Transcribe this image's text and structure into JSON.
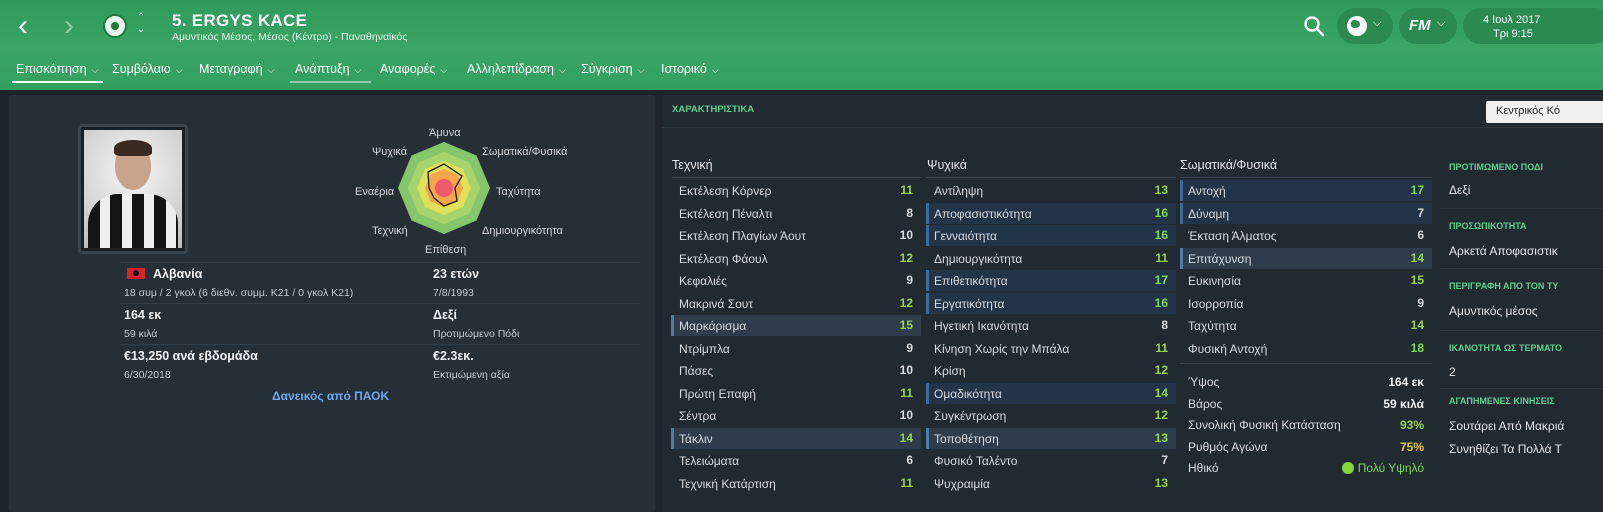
{
  "header": {
    "back_icon": "chevron-left-icon",
    "forward_icon": "chevron-right-icon",
    "player_name": "5. ERGYS KACE",
    "player_sub": "Αμυντικός Μέσος, Μέσος (Κέντρο) - Παναθηναϊκός",
    "fm_logo": "FM",
    "date": "4 Ιουλ 2017",
    "day_time": "Τρι 9:15"
  },
  "tabs": [
    {
      "label": "Επισκόπηση",
      "active": true
    },
    {
      "label": "Συμβόλαιο"
    },
    {
      "label": "Μεταγραφή"
    },
    {
      "label": "Ανάπτυξη"
    },
    {
      "label": "Αναφορές"
    },
    {
      "label": "Αλληλεπίδραση"
    },
    {
      "label": "Σύγκριση"
    },
    {
      "label": "Ιστορικό"
    }
  ],
  "radar": {
    "labels": {
      "top": "Άμυνα",
      "top_right": "Σωματικά/Φυσικά",
      "right": "Ταχύτητα",
      "bottom_right": "Δημιουργικότητα",
      "bottom": "Επίθεση",
      "bottom_left": "Τεχνική",
      "left": "Εναέρια",
      "top_left": "Ψυχικά"
    }
  },
  "info": {
    "nation": "Αλβανία",
    "caps": "18 συμ / 2 γκολ (6 διεθν. συμμ. Κ21 / 0 γκολ Κ21)",
    "age": "23 ετών",
    "dob": "7/8/1993",
    "height": "164 εκ",
    "weight": "59 κιλά",
    "foot": "Δεξί",
    "foot_label": "Προτιμώμενο Πόδι",
    "wage": "€13,250 ανά εβδομάδα",
    "contract_end": "6/30/2018",
    "value": "€2.3εκ.",
    "value_label": "Εκτιμώμενη αξία",
    "loan": "Δανεικός από ΠΑΟΚ"
  },
  "attributes": {
    "section_title": "ΧΑΡΑΚΤΗΡΙΣΤΙΚΑ",
    "role_button": "Κεντρικός Κό",
    "technical_title": "Τεχνική",
    "mental_title": "Ψυχικά",
    "physical_title": "Σωματικά/Φυσικά",
    "technical": [
      {
        "name": "Εκτέλεση Κόρνερ",
        "value": "11"
      },
      {
        "name": "Εκτέλεση Πέναλτι",
        "value": "8"
      },
      {
        "name": "Εκτέλεση Πλαγίων Άουτ",
        "value": "10"
      },
      {
        "name": "Εκτέλεση Φάουλ",
        "value": "12"
      },
      {
        "name": "Κεφαλιές",
        "value": "9"
      },
      {
        "name": "Μακρινά Σουτ",
        "value": "12"
      },
      {
        "name": "Μαρκάρισμα",
        "value": "15"
      },
      {
        "name": "Ντρίμπλα",
        "value": "9"
      },
      {
        "name": "Πάσες",
        "value": "10"
      },
      {
        "name": "Πρώτη Επαφή",
        "value": "11"
      },
      {
        "name": "Σέντρα",
        "value": "10"
      },
      {
        "name": "Τάκλιν",
        "value": "14"
      },
      {
        "name": "Τελειώματα",
        "value": "6"
      },
      {
        "name": "Τεχνική Κατάρτιση",
        "value": "11"
      }
    ],
    "mental": [
      {
        "name": "Αντίληψη",
        "value": "13"
      },
      {
        "name": "Αποφασιστικότητα",
        "value": "16"
      },
      {
        "name": "Γενναιότητα",
        "value": "16"
      },
      {
        "name": "Δημιουργικότητα",
        "value": "11"
      },
      {
        "name": "Επιθετικότητα",
        "value": "17"
      },
      {
        "name": "Εργατικότητα",
        "value": "16"
      },
      {
        "name": "Ηγετική Ικανότητα",
        "value": "8"
      },
      {
        "name": "Κίνηση Χωρίς την Μπάλα",
        "value": "11"
      },
      {
        "name": "Κρίση",
        "value": "12"
      },
      {
        "name": "Ομαδικότητα",
        "value": "14"
      },
      {
        "name": "Συγκέντρωση",
        "value": "12"
      },
      {
        "name": "Τοποθέτηση",
        "value": "13"
      },
      {
        "name": "Φυσικό Ταλέντο",
        "value": "7"
      },
      {
        "name": "Ψυχραιμία",
        "value": "13"
      }
    ],
    "physical": [
      {
        "name": "Αντοχή",
        "value": "17"
      },
      {
        "name": "Δύναμη",
        "value": "7"
      },
      {
        "name": "Έκταση Άλματος",
        "value": "6"
      },
      {
        "name": "Επιτάχυνση",
        "value": "14"
      },
      {
        "name": "Ευκινησία",
        "value": "15"
      },
      {
        "name": "Ισορροπία",
        "value": "9"
      },
      {
        "name": "Ταχύτητα",
        "value": "14"
      },
      {
        "name": "Φυσική Αντοχή",
        "value": "18"
      }
    ],
    "physical_info": [
      {
        "label": "Ύψος",
        "value": "164 εκ"
      },
      {
        "label": "Βάρος",
        "value": "59 κιλά"
      },
      {
        "label": "Συνολική Φυσική Κατάσταση",
        "value": "93%"
      },
      {
        "label": "Ρυθμός Αγώνα",
        "value": "75%"
      },
      {
        "label": "Ηθικό",
        "value": "Πολύ Υψηλό"
      }
    ]
  },
  "side": {
    "preferred_foot_head": "ΠΡΟΤΙΜΩΜΕΝΟ ΠΟΔΙ",
    "preferred_foot": "Δεξί",
    "personality_head": "ΠΡΟΣΩΠΙΚΟΤΗΤΑ",
    "personality": "Αρκετά Αποφασιστικ",
    "media_head": "ΠΕΡΙΓΡΑΦΗ ΑΠΟ ΤΟΝ ΤΥ",
    "media": "Αμυντικός μέσος",
    "ability_head": "ΙΚΑΝΟΤΗΤΑ ΩΣ ΤΕΡΜΑΤΟ",
    "ability": "2",
    "moves_head": "ΑΓΑΠΗΜΕΝΕΣ ΚΙΝΗΣΕΙΣ",
    "move1": "Σουτάρει Από Μακριά",
    "move2": "Συνηθίζει Τα Πολλά Τ"
  },
  "colors": {
    "header_green": "#3aa565",
    "val_high": "#9ad24a",
    "val_mid": "#d8dce0",
    "val_top": "#7ed957",
    "link": "#6ea8f0",
    "accent_green": "#5fd08e"
  }
}
